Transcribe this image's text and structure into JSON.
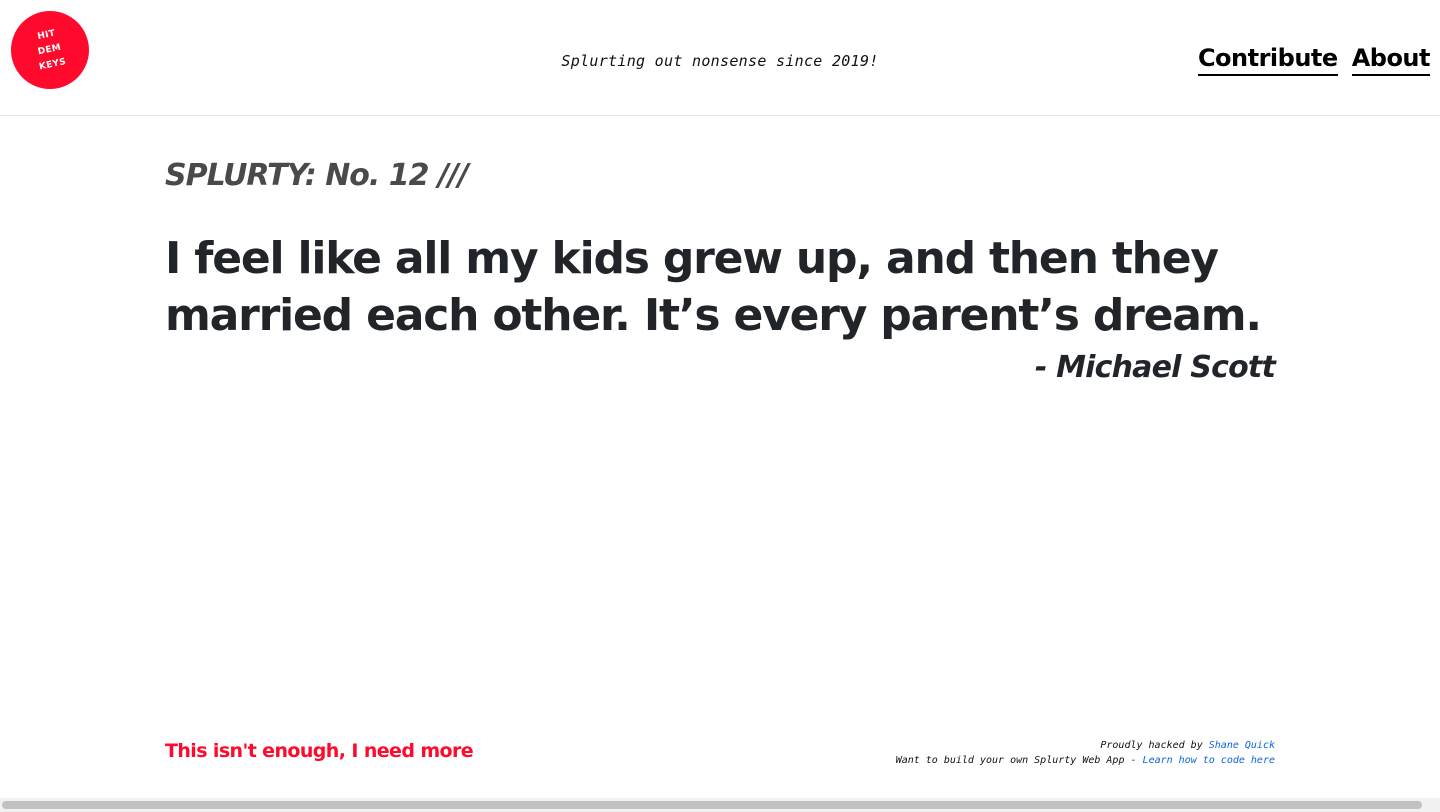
{
  "header": {
    "logo_lines": [
      "HIT",
      "DEM",
      "KEYS"
    ],
    "tagline": "Splurting out nonsense since 2019!",
    "nav": {
      "contribute": "Contribute",
      "about": "About"
    }
  },
  "main": {
    "edition": "SPLURTY: No. 12 ///",
    "quote": "I feel like all my kids grew up, and then they married each other. It’s every parent’s dream.",
    "author": "- Michael Scott"
  },
  "footer": {
    "more_link": "This isn't enough, I need more",
    "credit_prefix": "Proudly hacked by",
    "credit_name": "Shane Quick",
    "build_prefix": "Want to build your own Splurty Web App -",
    "build_link": "Learn how to code here"
  },
  "colors": {
    "brand_red": "#ff0a2c",
    "link_blue": "#0a66e0",
    "text_dark": "#212529"
  }
}
